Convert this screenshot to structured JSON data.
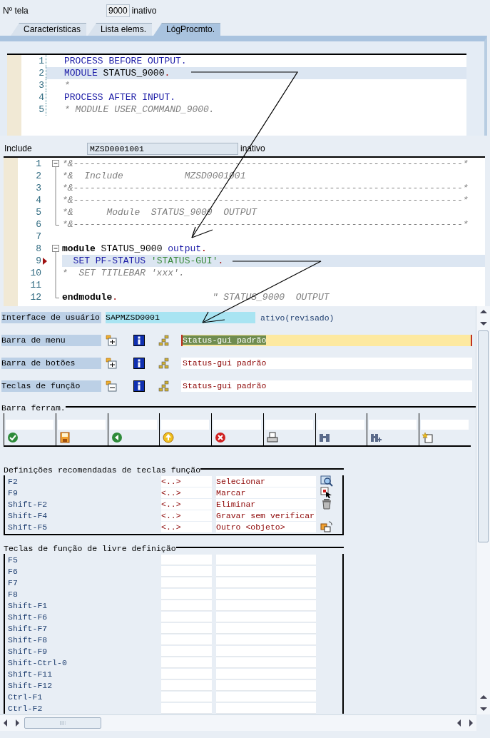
{
  "screen_number": {
    "label": "Nº tela",
    "value": "9000",
    "status": "inativo"
  },
  "tabs": [
    {
      "label": "Características",
      "selected": false
    },
    {
      "label": "Lista elems.",
      "selected": false
    },
    {
      "label": "LógProcmto.",
      "selected": true
    }
  ],
  "flow_logic": {
    "lines": [
      {
        "number": "1",
        "selected": false,
        "tokens": [
          {
            "kind": "keyword",
            "text": "PROCESS BEFORE OUTPUT."
          }
        ]
      },
      {
        "number": "2",
        "selected": true,
        "tokens": [
          {
            "kind": "keyword",
            "text": "MODULE"
          },
          {
            "kind": "plain",
            "text": " STATUS_9000"
          },
          {
            "kind": "punct",
            "text": "."
          }
        ]
      },
      {
        "number": "3",
        "selected": false,
        "tokens": [
          {
            "kind": "comment",
            "text": "*"
          }
        ]
      },
      {
        "number": "4",
        "selected": false,
        "tokens": [
          {
            "kind": "keyword",
            "text": "PROCESS AFTER INPUT."
          }
        ]
      },
      {
        "number": "5",
        "selected": false,
        "tokens": [
          {
            "kind": "comment",
            "text": "* MODULE USER_COMMAND_9000."
          }
        ]
      }
    ]
  },
  "include": {
    "label": "Include",
    "value": "MZSD0001001",
    "status": "inativo"
  },
  "include_source": {
    "lines": [
      {
        "number": "1",
        "selected": false,
        "breakpoint": false,
        "kind": "fold_start",
        "tokens": [
          {
            "kind": "comment",
            "text": "*&----------------------------------------------------------------------*"
          }
        ]
      },
      {
        "number": "2",
        "selected": false,
        "breakpoint": false,
        "kind": "fold_line",
        "tokens": [
          {
            "kind": "comment",
            "text": "*&  Include           MZSD0001001"
          }
        ]
      },
      {
        "number": "3",
        "selected": false,
        "breakpoint": false,
        "kind": "fold_line",
        "tokens": [
          {
            "kind": "comment",
            "text": "*&----------------------------------------------------------------------*"
          }
        ]
      },
      {
        "number": "4",
        "selected": false,
        "breakpoint": false,
        "kind": "fold_line",
        "tokens": [
          {
            "kind": "comment",
            "text": "*&----------------------------------------------------------------------*"
          }
        ]
      },
      {
        "number": "5",
        "selected": false,
        "breakpoint": false,
        "kind": "fold_line",
        "tokens": [
          {
            "kind": "comment",
            "text": "*&      Module  STATUS_9000  OUTPUT"
          }
        ]
      },
      {
        "number": "6",
        "selected": false,
        "breakpoint": false,
        "kind": "fold_end",
        "tokens": [
          {
            "kind": "comment",
            "text": "*&----------------------------------------------------------------------*"
          }
        ]
      },
      {
        "number": "7",
        "selected": false,
        "breakpoint": false,
        "kind": "plain"
      },
      {
        "number": "8",
        "selected": false,
        "breakpoint": false,
        "kind": "fold_start",
        "tokens": [
          {
            "kind": "bold",
            "text": "module"
          },
          {
            "kind": "plain",
            "text": " STATUS_9000 "
          },
          {
            "kind": "keyword",
            "text": "output"
          },
          {
            "kind": "punct",
            "text": "."
          }
        ]
      },
      {
        "number": "9",
        "selected": true,
        "breakpoint": true,
        "kind": "fold_line",
        "tokens": [
          {
            "kind": "keyword",
            "text": "  SET PF-STATUS "
          },
          {
            "kind": "string",
            "text": "'STATUS-GUI'"
          },
          {
            "kind": "punct",
            "text": "."
          }
        ]
      },
      {
        "number": "10",
        "selected": false,
        "breakpoint": false,
        "kind": "fold_line",
        "tokens": [
          {
            "kind": "comment",
            "text": "*  SET TITLEBAR 'xxx'."
          }
        ]
      },
      {
        "number": "11",
        "selected": false,
        "breakpoint": false,
        "kind": "fold_line"
      },
      {
        "number": "12",
        "selected": false,
        "breakpoint": false,
        "kind": "fold_end",
        "tokens": [
          {
            "kind": "bold",
            "text": "endmodule"
          },
          {
            "kind": "punct",
            "text": "."
          },
          {
            "kind": "comment",
            "text": "                 \" STATUS_9000  OUTPUT"
          }
        ]
      }
    ]
  },
  "interface": {
    "label": "Interface de usuário",
    "value": "SAPMZSD0001",
    "status": "ativo(revisado)"
  },
  "status_rows": [
    {
      "label": "Barra de menu",
      "expanded": false,
      "value": "Status-gui padrão",
      "selected": true
    },
    {
      "label": "Barra de botões",
      "expanded": false,
      "value": "Status-gui padrão",
      "selected": false
    },
    {
      "label": "Teclas de função",
      "expanded": true,
      "value": "Status-gui padrão",
      "selected": false
    }
  ],
  "toolbar": {
    "title": "Barra ferram.",
    "items": [
      {
        "kind": "check"
      },
      {
        "kind": "save"
      },
      {
        "kind": "back"
      },
      {
        "kind": "up"
      },
      {
        "kind": "cancel"
      },
      {
        "kind": "print"
      },
      {
        "kind": "find"
      },
      {
        "kind": "find_next"
      },
      {
        "kind": "new"
      }
    ]
  },
  "recommended": {
    "title": "Definições recomendadas de teclas função",
    "rows": [
      {
        "key": "F2",
        "code": "<..>",
        "text": "Selecionar",
        "kind": "search"
      },
      {
        "key": "F9",
        "code": "<..>",
        "text": "Marcar",
        "kind": "mark"
      },
      {
        "key": "Shift-F2",
        "code": "<..>",
        "text": "Eliminar",
        "kind": "delete"
      },
      {
        "key": "Shift-F4",
        "code": "<..>",
        "text": "Gravar sem verificar",
        "kind": "plain"
      },
      {
        "key": "Shift-F5",
        "code": "<..>",
        "text": "Outro <objeto>",
        "kind": "other"
      }
    ]
  },
  "free_keys": {
    "title": "Teclas de função de livre definição",
    "rows": [
      {
        "key": "F5"
      },
      {
        "key": "F6"
      },
      {
        "key": "F7"
      },
      {
        "key": "F8"
      },
      {
        "key": "Shift-F1"
      },
      {
        "key": "Shift-F6"
      },
      {
        "key": "Shift-F7"
      },
      {
        "key": "Shift-F8"
      },
      {
        "key": "Shift-F9"
      },
      {
        "key": "Shift-Ctrl-0"
      },
      {
        "key": "Shift-F11"
      },
      {
        "key": "Shift-F12"
      },
      {
        "key": "Ctrl-F1"
      },
      {
        "key": "Ctrl-F2"
      }
    ]
  }
}
